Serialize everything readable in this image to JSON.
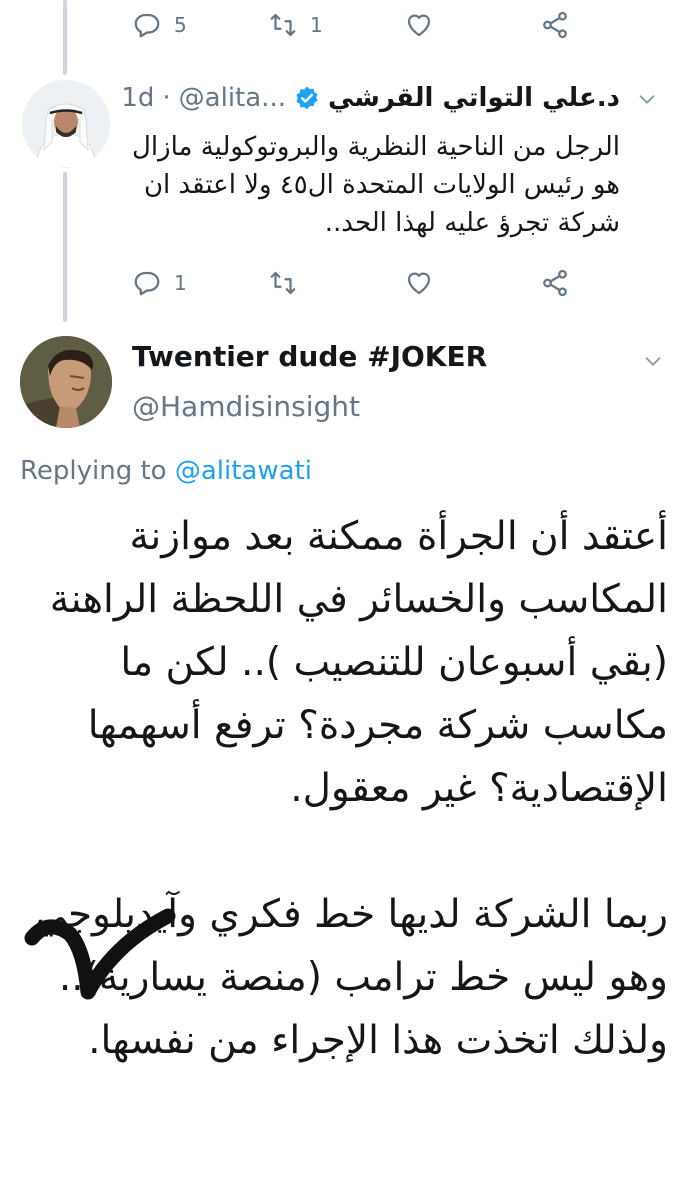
{
  "top_actions": {
    "reply_count": "5",
    "retweet_count": "1"
  },
  "reply_tweet": {
    "display_name": "د.علي التواتي القرشي",
    "handle": "@alita...",
    "separator": "·",
    "time": "1d",
    "text": "الرجل من الناحية النظرية والبروتوكولية مازال هو رئيس الولايات المتحدة ال٤٥ ولا اعتقد ان شركة تجرؤ عليه لهذا الحد..",
    "reply_count": "1",
    "retweet_count": "",
    "verified_color": "#1da1f2"
  },
  "main_tweet": {
    "display_name": "Twentier dude #JOKER",
    "handle": "@Hamdisinsight",
    "replying_prefix": "Replying to",
    "replying_to": "@alitawati",
    "paragraph1": "أعتقد أن الجرأة ممكنة بعد موازنة المكاسب والخسائر في اللحظة الراهنة (بقي أسبوعان للتنصيب ).. لكن ما مكاسب شركة مجردة؟ ترفع أسهمها الإقتصادية؟ غير معقول.",
    "paragraph2": "ربما الشركة لديها خط فكري وآيديلوجي وهو ليس خط ترامب (منصة يسارية).. ولذلك اتخذت هذا الإجراء من نفسها.",
    "link_color": "#1da1f2"
  },
  "icons": [
    "reply-icon",
    "retweet-icon",
    "like-icon",
    "share-icon",
    "verified-icon",
    "chevron-down-icon",
    "checkmark-annotation"
  ]
}
